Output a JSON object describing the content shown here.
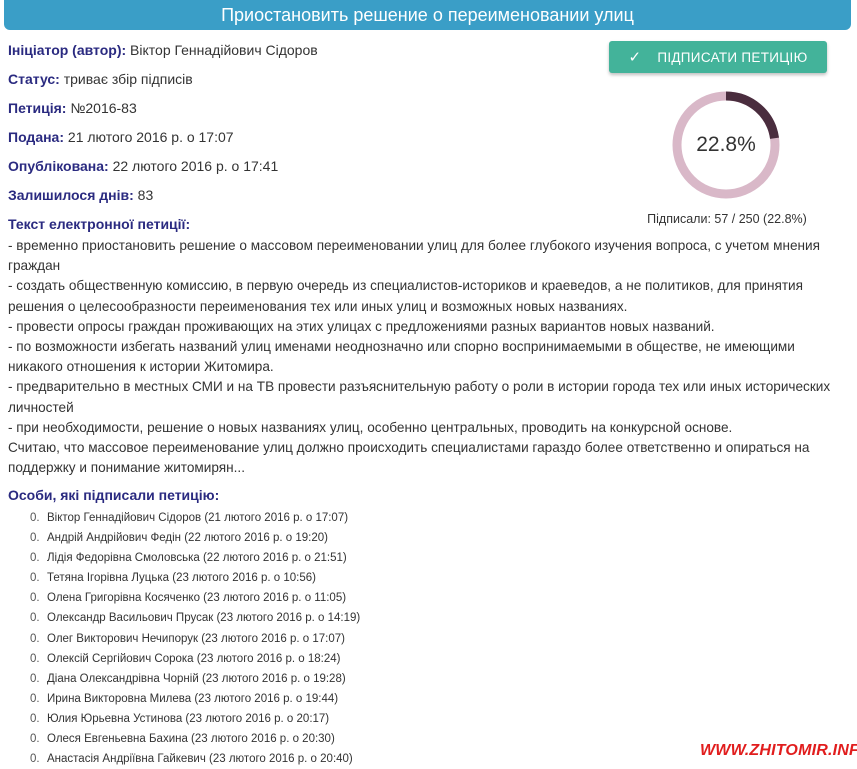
{
  "title": "Приостановить решение о переименовании улиц",
  "meta": [
    {
      "label": "Ініціатор (автор):",
      "value": "Віктор Геннадійович Сідоров"
    },
    {
      "label": "Статус:",
      "value": "триває збір підписів"
    },
    {
      "label": "Петиція:",
      "value": "№2016-83"
    },
    {
      "label": "Подана:",
      "value": "21 лютого 2016 р. о 17:07"
    },
    {
      "label": "Опублікована:",
      "value": "22 лютого 2016 р. о 17:41"
    },
    {
      "label": "Залишилося днів:",
      "value": "83"
    }
  ],
  "sign_button": {
    "icon": "check-icon",
    "label": "ПІДПИСАТИ ПЕТИЦІЮ",
    "color": "#43b39a"
  },
  "progress": {
    "percent": 22.8,
    "label": "22.8%",
    "signed_text": "Підписали: 57 / 250 (22.8%)",
    "fill_color": "#4a2d3e",
    "track_color": "#d9b8c8"
  },
  "petition_text": {
    "heading": "Текст електронної петиції:",
    "lines": [
      "- временно приостановить решение о массовом переименовании улиц для более глубокого изучения вопроса, с учетом мнения граждан",
      "- создать общественную комиссию, в первую очередь из специалистов-историков и краеведов, а не политиков, для принятия решения о целесообразности переименования тех или иных улиц и возможных новых названиях.",
      "- провести опросы граждан проживающих на этих улицах с предложениями разных вариантов новых названий.",
      "- по возможности избегать названий улиц именами неоднозначно или спорно воспринимаемыми в обществе, не имеющими никакого отношения к истории Житомира.",
      "- предварительно в местных СМИ и на ТВ провести разъяснительную работу о роли в истории города тех или иных исторических личностей",
      "- при необходимости, решение о новых названиях улиц, особенно центральных, проводить на конкурсной основе.",
      "Считаю, что массовое переименование улиц должно происходить специалистами гараздо более ответственно и опираться на поддержку и понимание житомирян..."
    ]
  },
  "signers": {
    "heading": "Особи, які підписали петицію:",
    "items": [
      {
        "num": "0.",
        "text": "Віктор Геннадійович Сідоров (21 лютого 2016 р. о 17:07)"
      },
      {
        "num": "0.",
        "text": "Андрій Андрійович Федін (22 лютого 2016 р. о 19:20)"
      },
      {
        "num": "0.",
        "text": "Лідія Федорівна Смоловська (22 лютого 2016 р. о 21:51)"
      },
      {
        "num": "0.",
        "text": "Тетяна Ігорівна Луцька (23 лютого 2016 р. о 10:56)"
      },
      {
        "num": "0.",
        "text": "Олена Григорівна Косяченко (23 лютого 2016 р. о 11:05)"
      },
      {
        "num": "0.",
        "text": "Олександр Васильович Прусак (23 лютого 2016 р. о 14:19)"
      },
      {
        "num": "0.",
        "text": "Олег Викторович Нечипорук (23 лютого 2016 р. о 17:07)"
      },
      {
        "num": "0.",
        "text": "Олексій Сергійович Сорока (23 лютого 2016 р. о 18:24)"
      },
      {
        "num": "0.",
        "text": "Діана Олександрівна Чорній (23 лютого 2016 р. о 19:28)"
      },
      {
        "num": "0.",
        "text": "Ирина Викторовна Милева (23 лютого 2016 р. о 19:44)"
      },
      {
        "num": "0.",
        "text": "Юлия Юрьевна Устинова (23 лютого 2016 р. о 20:17)"
      },
      {
        "num": "0.",
        "text": "Олеся Евгеньевна Бахина (23 лютого 2016 р. о 20:30)"
      },
      {
        "num": "0.",
        "text": "Анастасія Андріївна Гайкевич (23 лютого 2016 р. о 20:40)"
      }
    ]
  },
  "watermark": "WWW.ZHITOMIR.INFO"
}
